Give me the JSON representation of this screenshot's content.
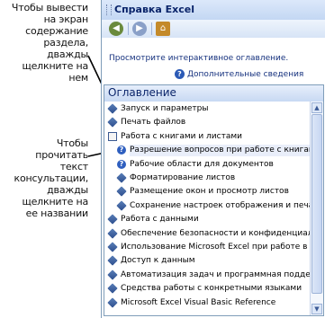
{
  "callouts": [
    {
      "text": "Чтобы вывести\nна экран\nсодержание\nраздела,\nдважды\nщелкните на\nнем"
    },
    {
      "text": "Чтобы\nпрочитать\nтекст\nконсультации,\nдважды\nщелкните на\nее названии"
    }
  ],
  "pane": {
    "title": "Справка Excel",
    "toolbar": {
      "back_icon": "back-arrow-icon",
      "forward_icon": "forward-arrow-icon",
      "home_icon": "home-icon"
    },
    "browse_link": "Просмотрите интерактивное оглавление.",
    "more_info_link": "Дополнительные сведения"
  },
  "toc": {
    "header": "Оглавление",
    "items": [
      {
        "label": "Запуск и параметры",
        "level": 0,
        "icon": "book-closed-icon"
      },
      {
        "label": "Печать файлов",
        "level": 0,
        "icon": "book-closed-icon"
      },
      {
        "label": "Работа с книгами и листами",
        "level": 0,
        "icon": "book-open-icon"
      },
      {
        "label": "Разрешение вопросов при работе с книгами",
        "level": 1,
        "icon": "help-page-icon",
        "selected": true
      },
      {
        "label": "Рабочие области для документов",
        "level": 1,
        "icon": "help-page-icon"
      },
      {
        "label": "Форматирование листов",
        "level": 1,
        "icon": "book-closed-icon"
      },
      {
        "label": "Размещение окон и просмотр листов",
        "level": 1,
        "icon": "book-closed-icon"
      },
      {
        "label": "Сохранение настроек отображения и печати",
        "level": 1,
        "icon": "book-closed-icon"
      },
      {
        "label": "Работа с данными",
        "level": 0,
        "icon": "book-closed-icon"
      },
      {
        "label": "Обеспечение безопасности и конфиденциальности",
        "level": 0,
        "icon": "book-closed-icon"
      },
      {
        "label": "Использование Microsoft Excel при работе в Интернете",
        "level": 0,
        "icon": "book-closed-icon"
      },
      {
        "label": "Доступ к данным",
        "level": 0,
        "icon": "book-closed-icon"
      },
      {
        "label": "Автоматизация задач и программная поддержка",
        "level": 0,
        "icon": "book-closed-icon"
      },
      {
        "label": "Средства работы с конкретными языками",
        "level": 0,
        "icon": "book-closed-icon"
      },
      {
        "label": "Microsoft Excel Visual Basic Reference",
        "level": 0,
        "icon": "book-closed-icon"
      }
    ]
  },
  "colors": {
    "accent": "#0a246a",
    "link": "#15317e",
    "selection": "#e9eefa"
  }
}
